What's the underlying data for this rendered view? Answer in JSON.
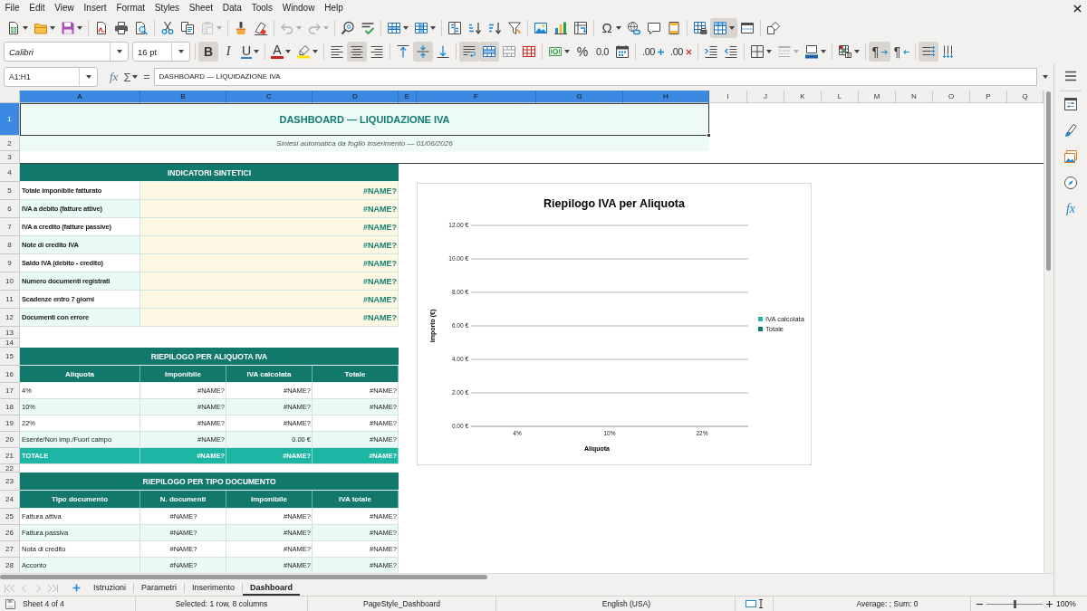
{
  "menu_bar": {
    "items": [
      "File",
      "Edit",
      "View",
      "Insert",
      "Format",
      "Styles",
      "Sheet",
      "Data",
      "Tools",
      "Window",
      "Help"
    ]
  },
  "toolbar_standard": [
    {
      "kind": "new",
      "menu": true,
      "pressed": false,
      "disabled": false
    },
    {
      "kind": "open",
      "menu": true,
      "pressed": false,
      "disabled": false
    },
    {
      "kind": "save",
      "menu": true,
      "pressed": false,
      "disabled": false
    },
    {
      "kind": "separator"
    },
    {
      "kind": "pdf",
      "pressed": false,
      "disabled": false
    },
    {
      "kind": "print",
      "pressed": false,
      "disabled": false
    },
    {
      "kind": "preview",
      "pressed": false,
      "disabled": false
    },
    {
      "kind": "separator"
    },
    {
      "kind": "cut",
      "pressed": false,
      "disabled": false
    },
    {
      "kind": "copy",
      "pressed": false,
      "disabled": false
    },
    {
      "kind": "paste",
      "menu": true,
      "pressed": false,
      "disabled": true
    },
    {
      "kind": "separator"
    },
    {
      "kind": "clone",
      "pressed": false,
      "disabled": false
    },
    {
      "kind": "clear",
      "pressed": false,
      "disabled": false
    },
    {
      "kind": "separator"
    },
    {
      "kind": "undo",
      "menu": true,
      "pressed": false,
      "disabled": true
    },
    {
      "kind": "redo",
      "menu": true,
      "pressed": false,
      "disabled": true
    },
    {
      "kind": "separator"
    },
    {
      "kind": "find",
      "pressed": false,
      "disabled": false
    },
    {
      "kind": "spelling",
      "pressed": false,
      "disabled": false
    },
    {
      "kind": "separator"
    },
    {
      "kind": "rows",
      "menu": true,
      "pressed": false,
      "disabled": false
    },
    {
      "kind": "columns",
      "menu": true,
      "pressed": false,
      "disabled": false
    },
    {
      "kind": "separator"
    },
    {
      "kind": "sort",
      "pressed": false,
      "disabled": false
    },
    {
      "kind": "ascending",
      "pressed": false,
      "disabled": false
    },
    {
      "kind": "descending",
      "pressed": false,
      "disabled": false
    },
    {
      "kind": "filter",
      "pressed": false,
      "disabled": false
    },
    {
      "kind": "separator"
    },
    {
      "kind": "image",
      "pressed": false,
      "disabled": false
    },
    {
      "kind": "chart",
      "pressed": false,
      "disabled": false
    },
    {
      "kind": "pivot",
      "pressed": false,
      "disabled": false
    },
    {
      "kind": "separator"
    },
    {
      "kind": "special",
      "glyph": "Ω",
      "menu": true,
      "pressed": false,
      "disabled": false
    },
    {
      "kind": "link",
      "pressed": false,
      "disabled": false
    },
    {
      "kind": "comment",
      "pressed": false,
      "disabled": false
    },
    {
      "kind": "headers",
      "pressed": false,
      "disabled": false
    },
    {
      "kind": "separator"
    },
    {
      "kind": "printarea",
      "pressed": false,
      "disabled": false
    },
    {
      "kind": "freeze",
      "menu": true,
      "pressed": true,
      "disabled": false
    },
    {
      "kind": "split",
      "pressed": false,
      "disabled": false
    },
    {
      "kind": "separator"
    },
    {
      "kind": "shapes",
      "pressed": false,
      "disabled": false
    }
  ],
  "toolbar_formatting": [
    {
      "kind": "fontname",
      "value": "Calibri"
    },
    {
      "kind": "fontsize",
      "value": "16 pt"
    },
    {
      "kind": "separator"
    },
    {
      "kind": "bold",
      "glyph": "B",
      "pressed": true,
      "disabled": false
    },
    {
      "kind": "italic",
      "glyph": "I",
      "pressed": false,
      "disabled": false
    },
    {
      "kind": "underline",
      "glyph": "U",
      "menu": true,
      "pressed": false,
      "disabled": false
    },
    {
      "kind": "separator"
    },
    {
      "kind": "fontcolor",
      "glyph": "A",
      "menu": true,
      "pressed": false,
      "disabled": false
    },
    {
      "kind": "highlight",
      "menu": true,
      "pressed": false,
      "disabled": false
    },
    {
      "kind": "separator"
    },
    {
      "kind": "left",
      "pressed": false,
      "disabled": false
    },
    {
      "kind": "center",
      "pressed": true,
      "disabled": false
    },
    {
      "kind": "right",
      "pressed": false,
      "disabled": false
    },
    {
      "kind": "separator"
    },
    {
      "kind": "top",
      "pressed": false,
      "disabled": false
    },
    {
      "kind": "middle",
      "pressed": true,
      "disabled": false
    },
    {
      "kind": "bottom",
      "pressed": false,
      "disabled": false
    },
    {
      "kind": "separator"
    },
    {
      "kind": "wrap",
      "pressed": true,
      "disabled": false
    },
    {
      "kind": "mergecenter",
      "pressed": true,
      "disabled": false
    },
    {
      "kind": "merge",
      "pressed": false,
      "disabled": false
    },
    {
      "kind": "unmerge",
      "pressed": false,
      "disabled": false
    },
    {
      "kind": "separator"
    },
    {
      "kind": "currency",
      "menu": true,
      "pressed": false,
      "disabled": false
    },
    {
      "kind": "percent",
      "glyph": "%",
      "pressed": false,
      "disabled": false
    },
    {
      "kind": "number",
      "glyph": "0.0",
      "pressed": false,
      "disabled": false
    },
    {
      "kind": "date",
      "pressed": false,
      "disabled": false
    },
    {
      "kind": "separator"
    },
    {
      "kind": "adddecimal",
      "glyph": ".00",
      "pressed": false,
      "disabled": false
    },
    {
      "kind": "deldecimal",
      "glyph": ".00",
      "pressed": false,
      "disabled": false
    },
    {
      "kind": "separator"
    },
    {
      "kind": "indent",
      "pressed": false,
      "disabled": false
    },
    {
      "kind": "outdent",
      "pressed": false,
      "disabled": false
    },
    {
      "kind": "separator"
    },
    {
      "kind": "borders",
      "menu": true,
      "pressed": false,
      "disabled": false
    },
    {
      "kind": "borderstyle",
      "menu": true,
      "pressed": false,
      "disabled": true
    },
    {
      "kind": "bordercolor",
      "menu": true,
      "pressed": false,
      "disabled": false
    },
    {
      "kind": "separator"
    },
    {
      "kind": "conditional",
      "menu": true,
      "pressed": false,
      "disabled": false
    },
    {
      "kind": "separator"
    },
    {
      "kind": "ltr",
      "glyph": "¶",
      "pressed": true,
      "disabled": false
    },
    {
      "kind": "rtl",
      "glyph": "¶",
      "pressed": false,
      "disabled": false
    },
    {
      "kind": "separator"
    },
    {
      "kind": "horizontal",
      "pressed": true,
      "disabled": false
    },
    {
      "kind": "vertical",
      "pressed": false,
      "disabled": false
    }
  ],
  "formula_bar": {
    "name_box": "A1:H1",
    "function_glyph": "fx",
    "sum_glyph": "Σ",
    "equals_glyph": "=",
    "formula": "DASHBOARD — LIQUIDAZIONE IVA"
  },
  "sheet": {
    "columns": [
      {
        "label": "A",
        "selected": true
      },
      {
        "label": "B",
        "selected": true
      },
      {
        "label": "C",
        "selected": true
      },
      {
        "label": "D",
        "selected": true
      },
      {
        "label": "E",
        "selected": true
      },
      {
        "label": "F",
        "selected": true
      },
      {
        "label": "G",
        "selected": true
      },
      {
        "label": "H",
        "selected": true
      },
      {
        "label": "I",
        "selected": false
      },
      {
        "label": "J",
        "selected": false
      },
      {
        "label": "K",
        "selected": false
      },
      {
        "label": "L",
        "selected": false
      },
      {
        "label": "M",
        "selected": false
      },
      {
        "label": "N",
        "selected": false
      },
      {
        "label": "O",
        "selected": false
      },
      {
        "label": "P",
        "selected": false
      },
      {
        "label": "Q",
        "selected": false
      }
    ],
    "rows": [
      {
        "label": "1",
        "selected": true
      },
      {
        "label": "2",
        "selected": false
      },
      {
        "label": "3",
        "selected": false
      },
      {
        "label": "4",
        "selected": false
      },
      {
        "label": "5",
        "selected": false
      },
      {
        "label": "6",
        "selected": false
      },
      {
        "label": "7",
        "selected": false
      },
      {
        "label": "8",
        "selected": false
      },
      {
        "label": "9",
        "selected": false
      },
      {
        "label": "10",
        "selected": false
      },
      {
        "label": "11",
        "selected": false
      },
      {
        "label": "12",
        "selected": false
      },
      {
        "label": "13",
        "selected": false
      },
      {
        "label": "14",
        "selected": false
      },
      {
        "label": "15",
        "selected": false
      },
      {
        "label": "16",
        "selected": false
      },
      {
        "label": "17",
        "selected": false
      },
      {
        "label": "18",
        "selected": false
      },
      {
        "label": "19",
        "selected": false
      },
      {
        "label": "20",
        "selected": false
      },
      {
        "label": "21",
        "selected": false
      },
      {
        "label": "22",
        "selected": false
      },
      {
        "label": "23",
        "selected": false
      },
      {
        "label": "24",
        "selected": false
      },
      {
        "label": "25",
        "selected": false
      },
      {
        "label": "26",
        "selected": false
      },
      {
        "label": "27",
        "selected": false
      },
      {
        "label": "28",
        "selected": false
      }
    ],
    "title": "DASHBOARD — LIQUIDAZIONE IVA",
    "subtitle": "Sintesi automatica da foglio Inserimento — 01/06/2026",
    "indicators": {
      "title": "INDICATORI SINTETICI",
      "items": [
        {
          "label": "Totale imponibile fatturato",
          "value": "#NAME?"
        },
        {
          "label": "IVA a debito (fatture attive)",
          "value": "#NAME?"
        },
        {
          "label": "IVA a credito (fatture passive)",
          "value": "#NAME?"
        },
        {
          "label": "Note di credito IVA",
          "value": "#NAME?"
        },
        {
          "label": "Saldo IVA (debito - credito)",
          "value": "#NAME?"
        },
        {
          "label": "Numero documenti registrati",
          "value": "#NAME?"
        },
        {
          "label": "Scadenze entro 7 giorni",
          "value": "#NAME?"
        },
        {
          "label": "Documenti con errore",
          "value": "#NAME?"
        }
      ]
    },
    "rate_summary": {
      "title": "RIEPILOGO PER ALIQUOTA IVA",
      "columns": [
        {
          "label": "Aliquota",
          "kind": "text"
        },
        {
          "label": "Imponibile",
          "kind": "amount"
        },
        {
          "label": "IVA calcolata",
          "kind": "amount"
        },
        {
          "label": "Totale",
          "kind": "amount"
        }
      ],
      "rows": [
        {
          "kind": "data",
          "cells": [
            "4%",
            "#NAME?",
            "#NAME?",
            "#NAME?"
          ]
        },
        {
          "kind": "data",
          "cells": [
            "10%",
            "#NAME?",
            "#NAME?",
            "#NAME?"
          ]
        },
        {
          "kind": "data",
          "cells": [
            "22%",
            "#NAME?",
            "#NAME?",
            "#NAME?"
          ]
        },
        {
          "kind": "data",
          "cells": [
            "Esente/Non imp./Fuori campo",
            "#NAME?",
            "0.00 €",
            "#NAME?"
          ]
        },
        {
          "kind": "total",
          "cells": [
            "TOTALE",
            "#NAME?",
            "#NAME?",
            "#NAME?"
          ]
        }
      ]
    },
    "document_summary": {
      "title": "RIEPILOGO PER TIPO DOCUMENTO",
      "columns": [
        {
          "label": "Tipo documento",
          "kind": "text"
        },
        {
          "label": "N. documenti",
          "kind": "count"
        },
        {
          "label": "Imponibile",
          "kind": "amount"
        },
        {
          "label": "IVA totale",
          "kind": "amount"
        }
      ],
      "rows": [
        {
          "kind": "data",
          "cells": [
            "Fattura attiva",
            "#NAME?",
            "#NAME?",
            "#NAME?"
          ]
        },
        {
          "kind": "data",
          "cells": [
            "Fattura passiva",
            "#NAME?",
            "#NAME?",
            "#NAME?"
          ]
        },
        {
          "kind": "data",
          "cells": [
            "Nota di credito",
            "#NAME?",
            "#NAME?",
            "#NAME?"
          ]
        },
        {
          "kind": "data",
          "cells": [
            "Acconto",
            "#NAME?",
            "#NAME?",
            "#NAME?"
          ]
        }
      ]
    },
    "chart": {
      "chart_data": {
        "type": "bar",
        "title": "Riepilogo IVA per Aliquota",
        "xlabel": "Aliquota",
        "ylabel": "Importo (€)",
        "categories": [
          "4%",
          "10%",
          "22%"
        ],
        "series": [
          {
            "name": "IVA calcolata",
            "color": "#2ab3a3",
            "values": [
              null,
              null,
              null
            ]
          },
          {
            "name": "Totale",
            "color": "#137a6e",
            "values": [
              null,
              null,
              null
            ]
          }
        ],
        "ylim": [
          0,
          12
        ],
        "yticks": [
          {
            "value": 0,
            "label": "0.00 €"
          },
          {
            "value": 2,
            "label": "2.00 €"
          },
          {
            "value": 4,
            "label": "4.00 €"
          },
          {
            "value": 6,
            "label": "6.00 €"
          },
          {
            "value": 8,
            "label": "8.00 €"
          },
          {
            "value": 10,
            "label": "10.00 €"
          },
          {
            "value": 12,
            "label": "12.00 €"
          }
        ],
        "grid": true
      }
    }
  },
  "sheet_navigation": [
    {
      "kind": "first",
      "disabled": true
    },
    {
      "kind": "previous",
      "disabled": true
    },
    {
      "kind": "next",
      "disabled": true
    },
    {
      "kind": "last",
      "disabled": true
    }
  ],
  "sheet_tabs": [
    {
      "label": "Istruzioni",
      "selected": false
    },
    {
      "label": "Parametri",
      "selected": false
    },
    {
      "label": "Inserimento",
      "selected": false
    },
    {
      "label": "Dashboard",
      "selected": true
    }
  ],
  "sidebar": [
    {
      "kind": "menu"
    },
    {
      "kind": "properties"
    },
    {
      "kind": "styles"
    },
    {
      "kind": "gallery"
    },
    {
      "kind": "navigator"
    },
    {
      "kind": "functions",
      "glyph": "fx"
    }
  ],
  "status_bar": {
    "sheet": "Sheet 4 of 4",
    "selection": "Selected: 1 row, 8 columns",
    "page_style": "PageStyle_Dashboard",
    "language": "English (USA)",
    "summary": "Average: ; Sum: 0",
    "zoom": {
      "level": 0.5,
      "reading": "100%"
    }
  }
}
